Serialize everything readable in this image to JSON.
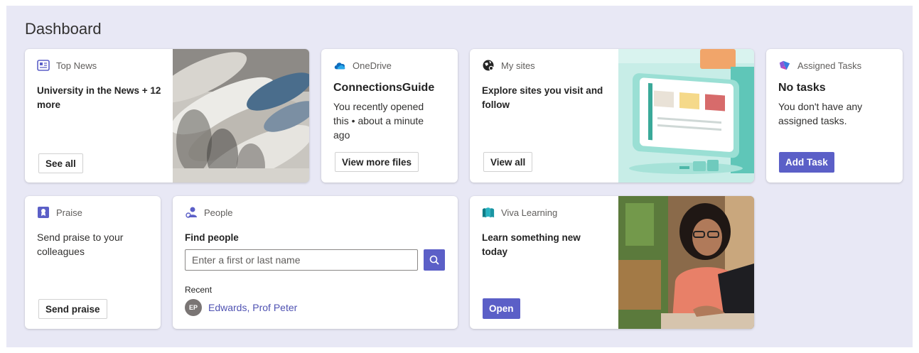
{
  "dashboard": {
    "title": "Dashboard"
  },
  "top_news": {
    "header": "Top News",
    "icon": "news-icon",
    "title": "University in the News + 12 more",
    "button": "See all"
  },
  "onedrive": {
    "header": "OneDrive",
    "icon": "cloud-icon",
    "title": "ConnectionsGuide",
    "text": "You recently opened this • about a minute ago",
    "button": "View more files"
  },
  "my_sites": {
    "header": "My sites",
    "icon": "globe-icon",
    "title": "Explore sites you visit and follow",
    "button": "View all"
  },
  "assigned_tasks": {
    "header": "Assigned Tasks",
    "icon": "planner-icon",
    "title": "No tasks",
    "text": "You don't have any assigned tasks.",
    "button": "Add Task"
  },
  "praise": {
    "header": "Praise",
    "icon": "badge-icon",
    "text": "Send praise to your colleagues",
    "button": "Send praise"
  },
  "people": {
    "header": "People",
    "icon": "people-icon",
    "title": "Find people",
    "search_placeholder": "Enter a first or last name",
    "recent_label": "Recent",
    "recent": [
      {
        "initials": "EP",
        "name": "Edwards, Prof Peter"
      }
    ]
  },
  "viva_learning": {
    "header": "Viva Learning",
    "icon": "book-icon",
    "title": "Learn something new today",
    "button": "Open"
  },
  "colors": {
    "accent": "#5b5fc7",
    "link": "#4f52b2",
    "background": "#e8e8f5"
  }
}
